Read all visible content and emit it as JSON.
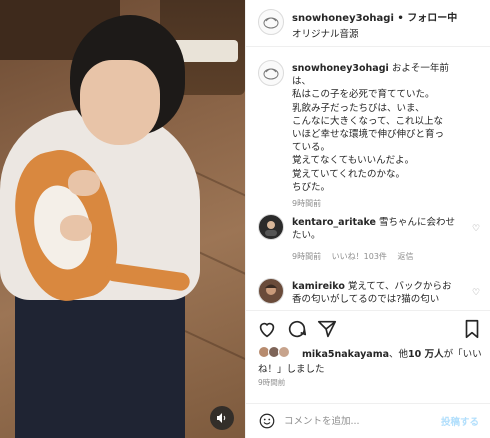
{
  "post": {
    "username": "snowhoney3ohagi",
    "separator": "•",
    "follow_label": "フォロー中",
    "audio": "オリジナル音源",
    "caption": [
      "およそ一年前は、",
      "私はこの子を必死で育てていた。",
      "乳飲み子だったちびは、いま、",
      "こんなに大きくなって、これ以上な",
      "いほど幸せな環境で伸び伸びと育っ",
      "ている。",
      "覚えてなくてもいいんだよ。",
      "覚えていてくれたのかな。",
      "ちびた。"
    ],
    "caption_time": "9時間前"
  },
  "comments": [
    {
      "username": "kentaro_aritake",
      "text": "雪ちゃんに会わせたい。",
      "time": "9時間前",
      "likes": "いいね！103件",
      "reply": "返信"
    },
    {
      "username": "kamireiko",
      "text": "覚えてて、バックからお",
      "text2": "香の匂いがしてるのでは?猫の匂い"
    }
  ],
  "likes": {
    "liker": "mika5nakayama",
    "text_mid": "、他",
    "count": "10 万人",
    "text_end": "が「いい",
    "line2": "ね！」しました"
  },
  "timestamp": "9時間前",
  "add_comment": {
    "placeholder": "コメントを追加...",
    "post_label": "投稿する"
  },
  "icons": {
    "sound": "speaker-icon",
    "heart": "heart-icon",
    "comment": "comment-icon",
    "share": "share-icon",
    "save": "bookmark-icon",
    "emoji": "smiley-icon"
  }
}
